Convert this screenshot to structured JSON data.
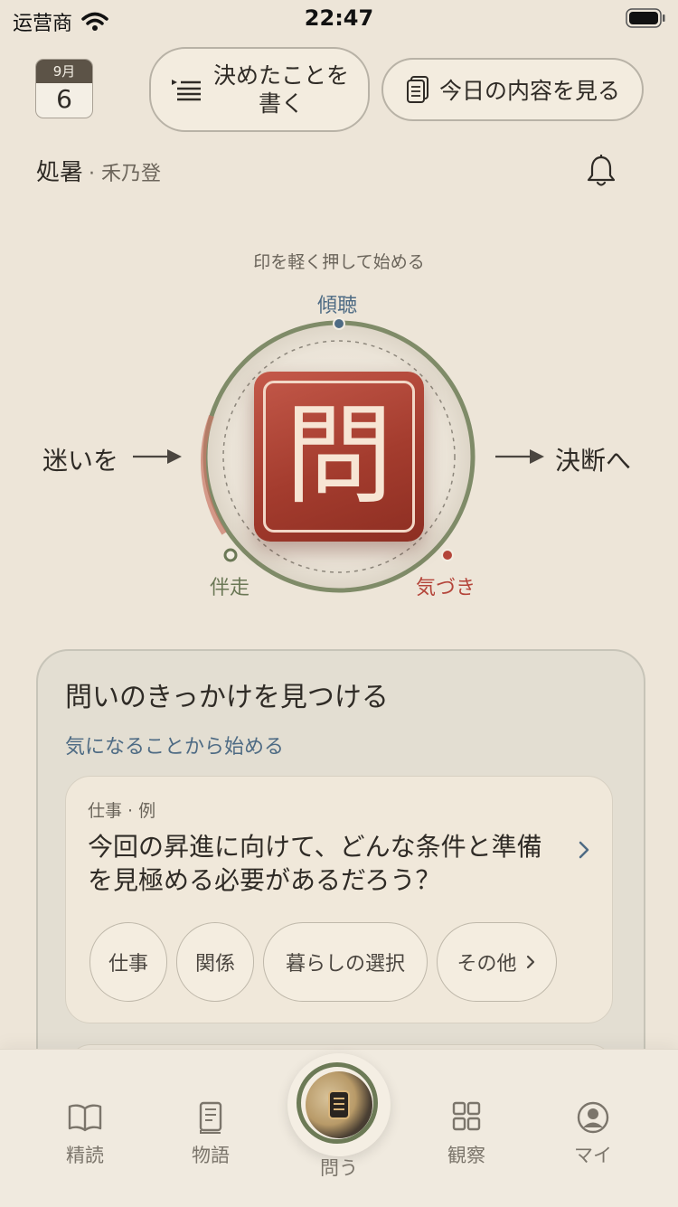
{
  "status": {
    "carrier": "运营商",
    "time": "22:47"
  },
  "calendar": {
    "month": "9月",
    "day": "6"
  },
  "header": {
    "write_decision": "決めたことを\n書く",
    "view_today": "今日の内容を見る"
  },
  "solar_term": {
    "name": "処暑",
    "sub": "· 禾乃登"
  },
  "dial": {
    "hint": "印を軽く押して始める",
    "top": "傾聴",
    "bottom_left": "伴走",
    "bottom_right": "気づき",
    "left": "迷いを",
    "right": "決断へ",
    "seal_char": "問"
  },
  "card": {
    "title": "問いのきっかけを見つける",
    "subtitle": "気になることから始める",
    "example_tag": "仕事 · 例",
    "example_question": "今回の昇進に向けて、どんな条件と準備を見極める必要があるだろう？",
    "chips": [
      "仕事",
      "関係",
      "暮らしの選択",
      "その他"
    ]
  },
  "tabs": {
    "read": "精読",
    "story": "物語",
    "ask": "問う",
    "observe": "観察",
    "me": "マイ"
  },
  "colors": {
    "accent_blue": "#4e6b84",
    "accent_green": "#6b7856",
    "accent_red": "#b4453a",
    "seal_red": "#a43c2e"
  }
}
